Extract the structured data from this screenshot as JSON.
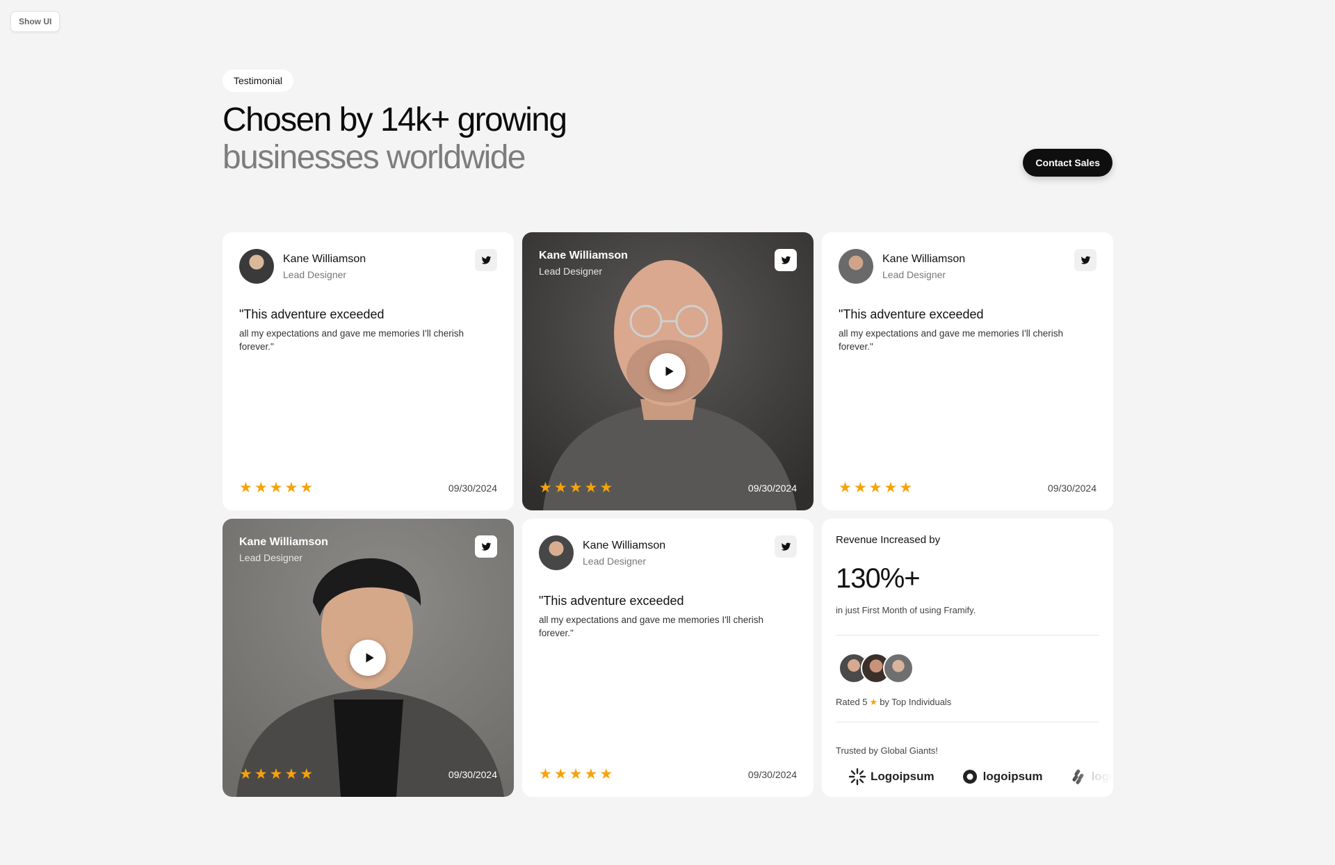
{
  "show_ui": "Show UI",
  "section": {
    "pill": "Testimonial",
    "headline_line1": "Chosen by 14k+ growing",
    "headline_line2": "businesses worldwide",
    "contact_button": "Contact Sales"
  },
  "cards": [
    {
      "name": "Kane Williamson",
      "role": "Lead Designer",
      "quote_title": "\"This adventure exceeded",
      "quote_body": "all my expectations and gave me memories I'll cherish forever.\"",
      "rating": 5,
      "date": "09/30/2024"
    },
    {
      "name": "Kane Williamson",
      "role": "Lead Designer",
      "rating": 5,
      "date": "09/30/2024"
    },
    {
      "name": "Kane Williamson",
      "role": "Lead Designer",
      "quote_title": "\"This adventure exceeded",
      "quote_body": "all my expectations and gave me memories I'll cherish forever.\"",
      "rating": 5,
      "date": "09/30/2024"
    },
    {
      "name": "Kane Williamson",
      "role": "Lead Designer",
      "rating": 5,
      "date": "09/30/2024"
    },
    {
      "name": "Kane Williamson",
      "role": "Lead Designer",
      "quote_title": "\"This adventure exceeded",
      "quote_body": "all my expectations and gave me memories I'll cherish forever.\"",
      "rating": 5,
      "date": "09/30/2024"
    }
  ],
  "stats": {
    "title": "Revenue Increased by",
    "value": "130%+",
    "subtitle": "in just First Month of using Framify.",
    "rated_prefix": "Rated 5",
    "rated_suffix": "by Top Individuals",
    "trusted": "Trusted by Global Giants!",
    "logos": [
      "Logoipsum",
      "logoipsum",
      "logoipsum"
    ]
  },
  "colors": {
    "star": "#f5a30a",
    "dark_button": "#0f0f0f",
    "page_bg": "#f4f4f4"
  }
}
